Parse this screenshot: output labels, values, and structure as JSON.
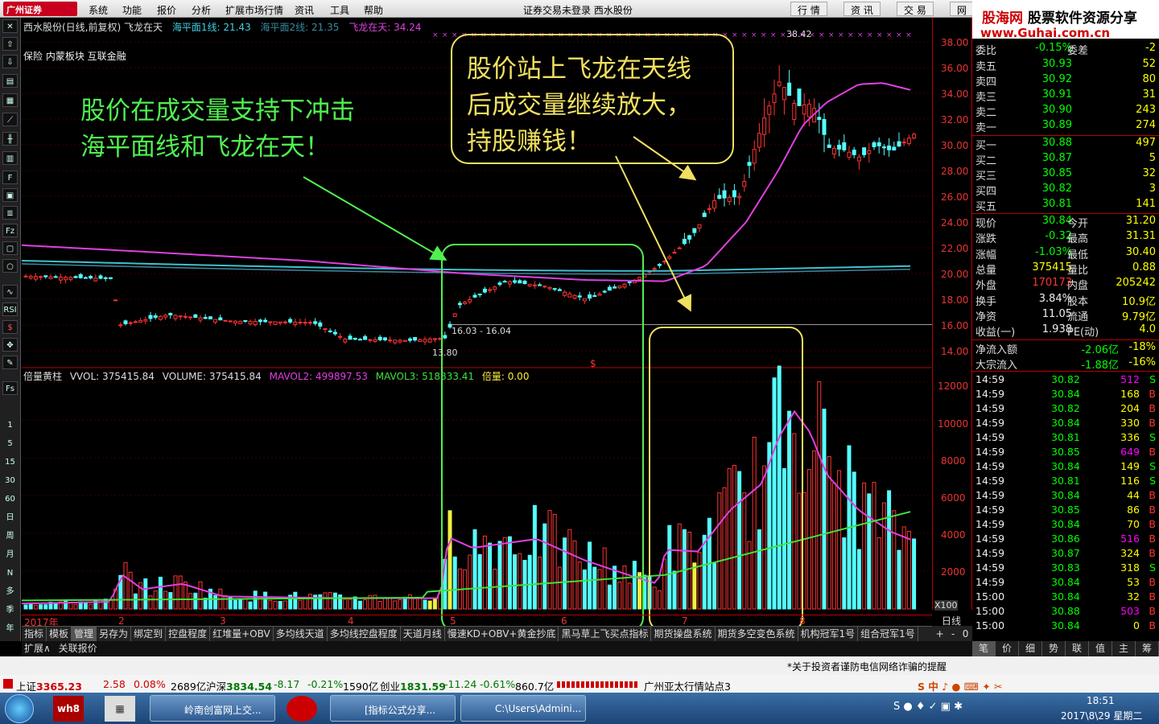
{
  "menubar": {
    "logo": "广州证券",
    "items": [
      "系统",
      "功能",
      "报价",
      "分析",
      "扩展市场行情",
      "资讯",
      "工具",
      "帮助"
    ],
    "center": "证券交易未登录 西水股份",
    "right": [
      "行 情",
      "资 讯",
      "交 易",
      "网"
    ]
  },
  "brand": {
    "line1a": "股海网",
    "line1b": "股票软件资源分享",
    "line2": "www.Guhai.com.cn"
  },
  "chart_header": {
    "title": "西水股份(日线,前复权)",
    "indicator": "飞龙在天",
    "line1_label": "海平面1线: 21.43",
    "line2_label": "海平面2线: 21.35",
    "flydragon_label": "飞龙在天: 34.24",
    "sector": "保险 内蒙板块 互联金融"
  },
  "vol_header": {
    "name": "倍量黄柱",
    "vvol": "VVOL: 375415.84",
    "volume": "VOLUME: 375415.84",
    "mavol2": "MAVOL2: 499897.53",
    "mavol3": "MAVOL3: 518833.41",
    "beiliang": "倍量: 0.00"
  },
  "annotations": {
    "left": [
      "股价在成交量支持下冲击",
      "海平面线和飞龙在天！"
    ],
    "right": [
      "股价站上飞龙在天线",
      "后成交量继续放大，",
      "持股赚钱！"
    ],
    "high_label": "38.42",
    "low_label": "13.80",
    "range_label": "16.03 - 16.04"
  },
  "price_axis": [
    "38.00",
    "36.00",
    "34.00",
    "32.00",
    "30.00",
    "28.00",
    "26.00",
    "24.00",
    "22.00",
    "20.00",
    "18.00",
    "16.00",
    "14.00"
  ],
  "vol_axis": [
    "12000",
    "10000",
    "8000",
    "6000",
    "4000",
    "2000"
  ],
  "vol_unit": "X100",
  "x_axis": [
    "2017年",
    "2",
    "3",
    "4",
    "5",
    "6",
    "7",
    "8"
  ],
  "period": "日线",
  "left_toolbar": [
    "RSI",
    "$",
    "Fs",
    "1",
    "5",
    "15",
    "30",
    "60",
    "日",
    "周",
    "月",
    "N",
    "多",
    "季",
    "年"
  ],
  "quote": {
    "weibi": {
      "label": "委比",
      "value": "-0.15%",
      "label2": "委差",
      "value2": "-2"
    },
    "asks": [
      {
        "label": "卖五",
        "price": "30.93",
        "vol": "52"
      },
      {
        "label": "卖四",
        "price": "30.92",
        "vol": "80"
      },
      {
        "label": "卖三",
        "price": "30.91",
        "vol": "31"
      },
      {
        "label": "卖二",
        "price": "30.90",
        "vol": "243"
      },
      {
        "label": "卖一",
        "price": "30.89",
        "vol": "274"
      }
    ],
    "bids": [
      {
        "label": "买一",
        "price": "30.88",
        "vol": "497"
      },
      {
        "label": "买二",
        "price": "30.87",
        "vol": "5"
      },
      {
        "label": "买三",
        "price": "30.85",
        "vol": "32"
      },
      {
        "label": "买四",
        "price": "30.82",
        "vol": "3"
      },
      {
        "label": "买五",
        "price": "30.81",
        "vol": "141"
      }
    ],
    "stats": [
      {
        "l1": "现价",
        "v1": "30.84",
        "l2": "今开",
        "v2": "31.20",
        "c1": "grn",
        "c2": "red"
      },
      {
        "l1": "涨跌",
        "v1": "-0.32",
        "l2": "最高",
        "v2": "31.31",
        "c1": "grn",
        "c2": "red"
      },
      {
        "l1": "涨幅",
        "v1": "-1.03%",
        "l2": "最低",
        "v2": "30.40",
        "c1": "grn",
        "c2": "grn"
      },
      {
        "l1": "总量",
        "v1": "375415",
        "l2": "量比",
        "v2": "0.88",
        "c1": "yel",
        "c2": "yel"
      },
      {
        "l1": "外盘",
        "v1": "170173",
        "l2": "内盘",
        "v2": "205242",
        "c1": "red",
        "c2": "grn"
      },
      {
        "l1": "换手",
        "v1": "3.84%",
        "l2": "股本",
        "v2": "10.9亿",
        "c1": "wht",
        "c2": "wht"
      },
      {
        "l1": "净资",
        "v1": "11.05",
        "l2": "流通",
        "v2": "9.79亿",
        "c1": "wht",
        "c2": "wht"
      },
      {
        "l1": "收益(一)",
        "v1": "1.938",
        "l2": "PE(动)",
        "v2": "4.0",
        "c1": "wht",
        "c2": "wht"
      }
    ],
    "flows": [
      {
        "l": "净流入额",
        "v1": "-2.06亿",
        "v2": "-18%"
      },
      {
        "l": "大宗流入",
        "v1": "-1.88亿",
        "v2": "-16%"
      }
    ],
    "ticks": [
      {
        "t": "14:59",
        "p": "30.82",
        "v": "512",
        "s": "S"
      },
      {
        "t": "14:59",
        "p": "30.84",
        "v": "168",
        "s": "B"
      },
      {
        "t": "14:59",
        "p": "30.82",
        "v": "204",
        "s": "B"
      },
      {
        "t": "14:59",
        "p": "30.84",
        "v": "330",
        "s": "B"
      },
      {
        "t": "14:59",
        "p": "30.81",
        "v": "336",
        "s": "S"
      },
      {
        "t": "14:59",
        "p": "30.85",
        "v": "649",
        "s": "B"
      },
      {
        "t": "14:59",
        "p": "30.84",
        "v": "149",
        "s": "S"
      },
      {
        "t": "14:59",
        "p": "30.81",
        "v": "116",
        "s": "S"
      },
      {
        "t": "14:59",
        "p": "30.84",
        "v": "44",
        "s": "B"
      },
      {
        "t": "14:59",
        "p": "30.85",
        "v": "86",
        "s": "B"
      },
      {
        "t": "14:59",
        "p": "30.84",
        "v": "70",
        "s": "B"
      },
      {
        "t": "14:59",
        "p": "30.86",
        "v": "516",
        "s": "B"
      },
      {
        "t": "14:59",
        "p": "30.87",
        "v": "324",
        "s": "B"
      },
      {
        "t": "14:59",
        "p": "30.83",
        "v": "318",
        "s": "S"
      },
      {
        "t": "14:59",
        "p": "30.84",
        "v": "53",
        "s": "B"
      },
      {
        "t": "15:00",
        "p": "30.84",
        "v": "32",
        "s": "B"
      },
      {
        "t": "15:00",
        "p": "30.88",
        "v": "503",
        "s": "B"
      },
      {
        "t": "15:00",
        "p": "30.84",
        "v": "0",
        "s": "B"
      }
    ]
  },
  "tabs": [
    "指标",
    "模板",
    "管理",
    "另存为",
    "绑定到",
    "控盘程度",
    "红堆量+OBV",
    "多均线天道",
    "多均线控盘程度",
    "天道月线",
    "慢速KD+OBV+黄金抄底",
    "黑马草上飞买点指标",
    "期货操盘系统",
    "期货多空变色系统",
    "机构冠军1号",
    "组合冠军1号"
  ],
  "tabs_right": [
    "+",
    "-",
    "0"
  ],
  "tabs2": [
    "扩展∧",
    "关联报价"
  ],
  "rtabs": [
    "笔",
    "价",
    "细",
    "势",
    "联",
    "值",
    "主",
    "筹"
  ],
  "notice": "*关于投资者谨防电信网络诈骗的提醒",
  "ticker": {
    "sh": "上证",
    "sh_v": "3365.23",
    "sh_c": "2.58",
    "sh_p": "0.08%",
    "sh_a": "2689亿",
    "sz": "沪深",
    "sz_v": "3834.54",
    "sz_c": "-8.17",
    "sz_p": "-0.21%",
    "sz_a": "1590亿",
    "cy": "创业",
    "cy_v": "1831.59",
    "cy_c": "-11.24",
    "cy_p": "-0.61%",
    "cy_a": "860.7亿",
    "site": "广州亚太行情站点3"
  },
  "taskbar": {
    "apps": [
      "岭南创富网上交...",
      "[指标公式分享...",
      "C:\\Users\\Admini..."
    ],
    "time": "18:51",
    "date": "2017\\8\\29 星期二"
  },
  "colors": {
    "up": "#ff3333",
    "down": "#54ffff",
    "ma_magenta": "#e040e0",
    "ma_cyan": "#40c0d0",
    "mavol3": "#40e040",
    "green_box": "#50f050",
    "yellow_box": "#f0e060"
  }
}
